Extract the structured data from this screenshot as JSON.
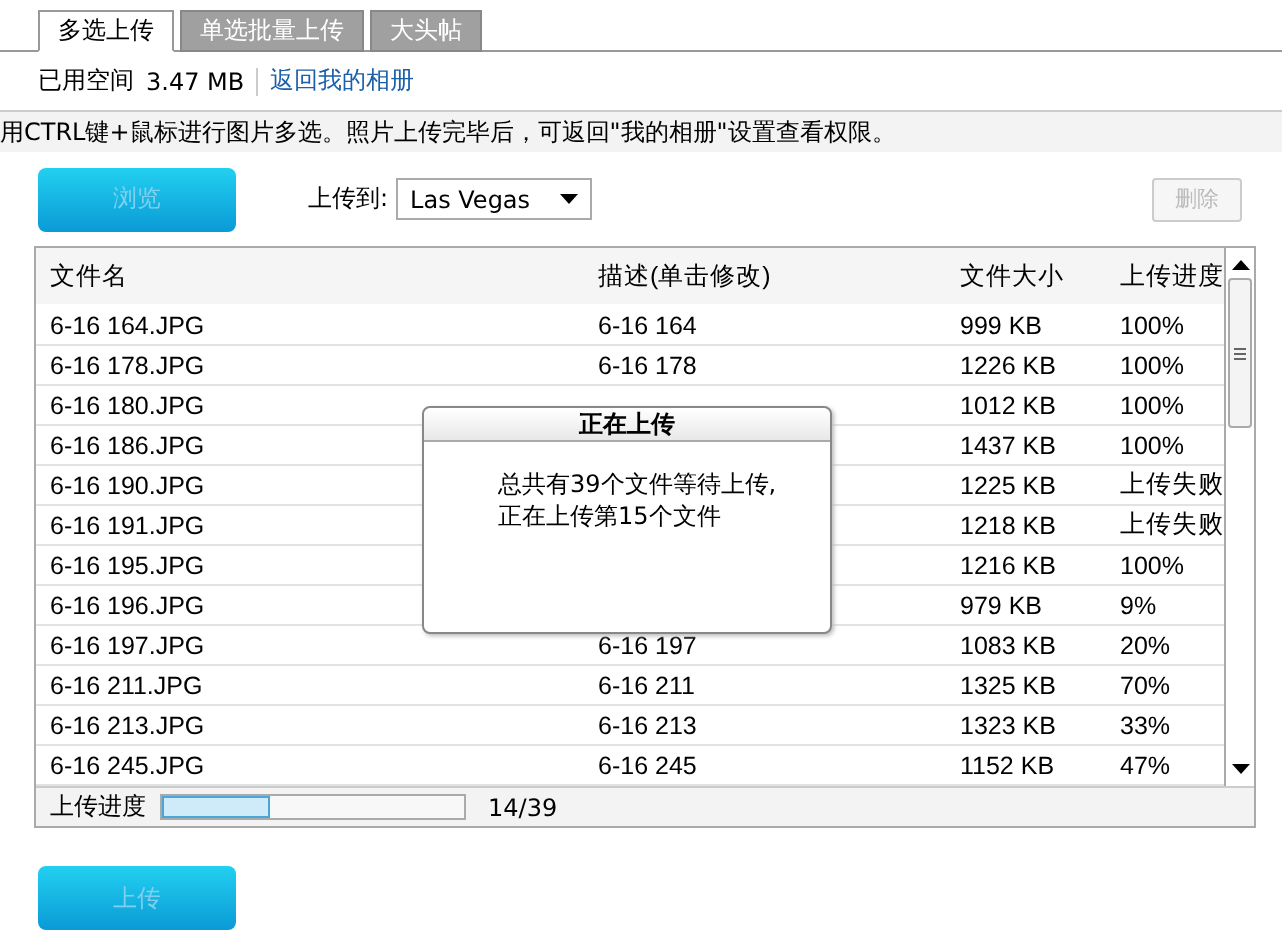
{
  "tabs": [
    {
      "label": "多选上传",
      "selected": true
    },
    {
      "label": "单选批量上传",
      "selected": false
    },
    {
      "label": "大头帖",
      "selected": false
    }
  ],
  "space": {
    "label": "已用空间",
    "value": "3.47 MB",
    "link": "返回我的相册"
  },
  "hint": "用CTRL键+鼠标进行图片多选。照片上传完毕后，可返回\"我的相册\"设置查看权限。",
  "toolbar": {
    "browse": "浏览",
    "upload_to_label": "上传到:",
    "album": "Las Vegas",
    "delete": {
      "label": "删除",
      "disabled": true
    }
  },
  "table": {
    "columns": [
      "文件名",
      "描述(单击修改)",
      "文件大小",
      "上传进度"
    ],
    "rows": [
      {
        "name": "6-16 164.JPG",
        "description": "6-16 164",
        "size": "999 KB",
        "progress": "100%"
      },
      {
        "name": "6-16 178.JPG",
        "description": "6-16 178",
        "size": "1226 KB",
        "progress": "100%"
      },
      {
        "name": "6-16 180.JPG",
        "size": "1012 KB",
        "progress": "100%"
      },
      {
        "name": "6-16 186.JPG",
        "size": "1437 KB",
        "progress": "100%"
      },
      {
        "name": "6-16 190.JPG",
        "size": "1225 KB",
        "progress": "上传失败"
      },
      {
        "name": "6-16 191.JPG",
        "size": "1218 KB",
        "progress": "上传失败"
      },
      {
        "name": "6-16 195.JPG",
        "size": "1216 KB",
        "progress": "100%"
      },
      {
        "name": "6-16 196.JPG",
        "size": "979 KB",
        "progress": "9%"
      },
      {
        "name": "6-16 197.JPG",
        "description": "6-16 197",
        "size": "1083 KB",
        "progress": "20%"
      },
      {
        "name": "6-16 211.JPG",
        "description": "6-16 211",
        "size": "1325 KB",
        "progress": "70%"
      },
      {
        "name": "6-16 213.JPG",
        "description": "6-16 213",
        "size": "1323 KB",
        "progress": "33%"
      },
      {
        "name": "6-16 245.JPG",
        "description": "6-16 245",
        "size": "1152 KB",
        "progress": "47%"
      }
    ]
  },
  "progress": {
    "label": "上传进度",
    "level": 0.36,
    "count": "14/39"
  },
  "dialog": {
    "title": "正在上传",
    "lines": [
      "总共有39个文件等待上传,",
      "正在上传第15个文件"
    ]
  },
  "upload_button": "上传"
}
